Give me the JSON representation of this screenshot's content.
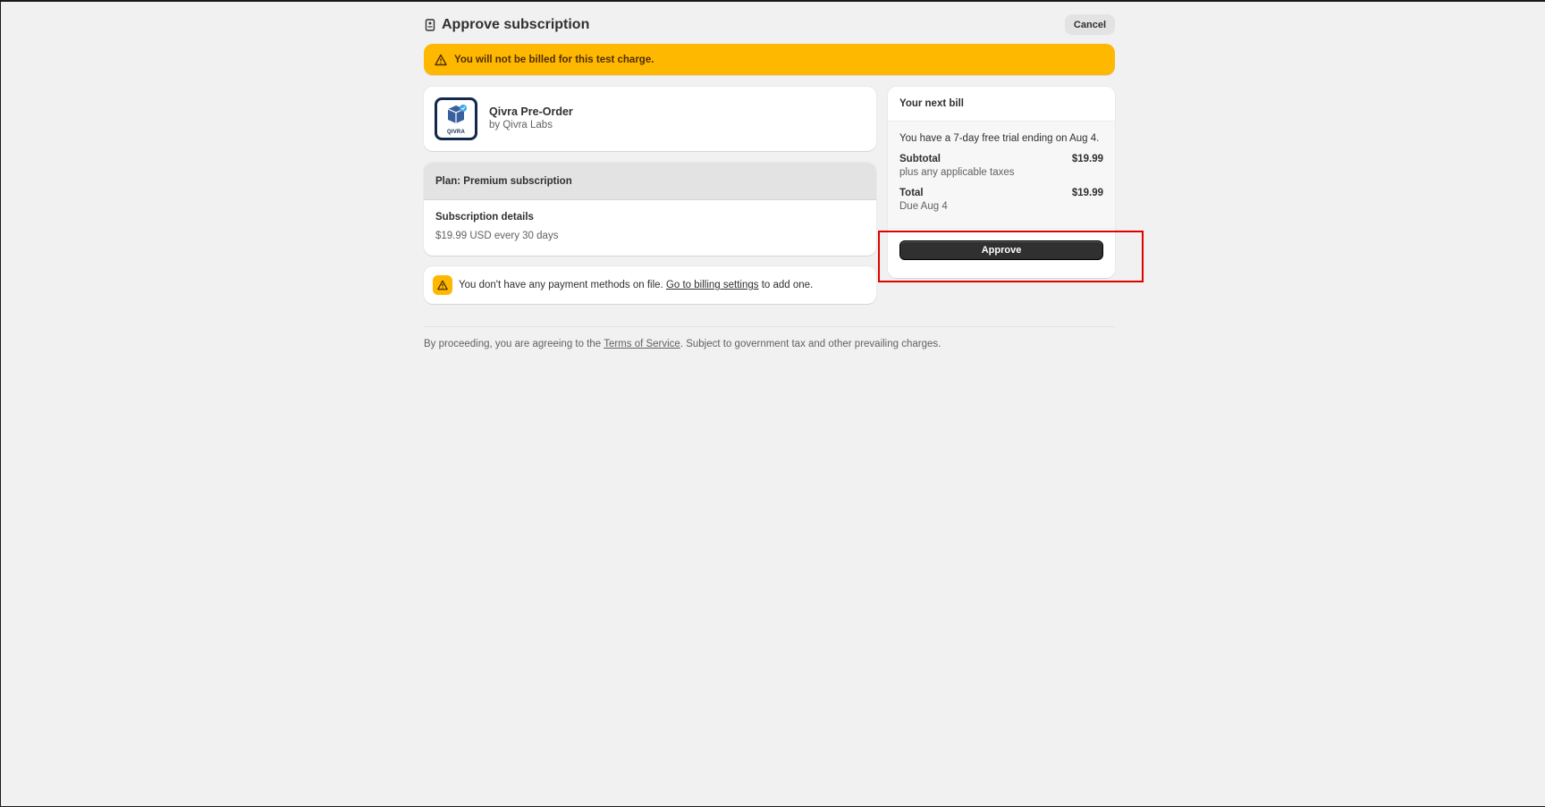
{
  "header": {
    "title": "Approve subscription",
    "cancel_label": "Cancel"
  },
  "banner": {
    "text": "You will not be billed for this test charge."
  },
  "app": {
    "name": "Qivra Pre-Order",
    "by": "by Qivra Labs",
    "logo_label": "QIVRA"
  },
  "plan": {
    "heading": "Plan: Premium subscription",
    "details_label": "Subscription details",
    "details_price": "$19.99 USD every 30 days"
  },
  "payment_warning": {
    "text_before": "You don't have any payment methods on file. ",
    "link": "Go to billing settings",
    "text_after": " to add one."
  },
  "bill": {
    "heading": "Your next bill",
    "trial_text": "You have a 7-day free trial ending on Aug 4.",
    "subtotal_label": "Subtotal",
    "subtotal_value": "$19.99",
    "subtotal_sub": "plus any applicable taxes",
    "total_label": "Total",
    "total_value": "$19.99",
    "total_sub": "Due Aug 4",
    "approve_label": "Approve"
  },
  "footer": {
    "text_before": "By proceeding, you are agreeing to the ",
    "tos_link": "Terms of Service",
    "text_after": ". Subject to government tax and other prevailing charges."
  },
  "colors": {
    "banner_bg": "#ffb800",
    "approve_bg": "#303030",
    "page_bg": "#f1f1f1",
    "highlight": "#e00000"
  }
}
